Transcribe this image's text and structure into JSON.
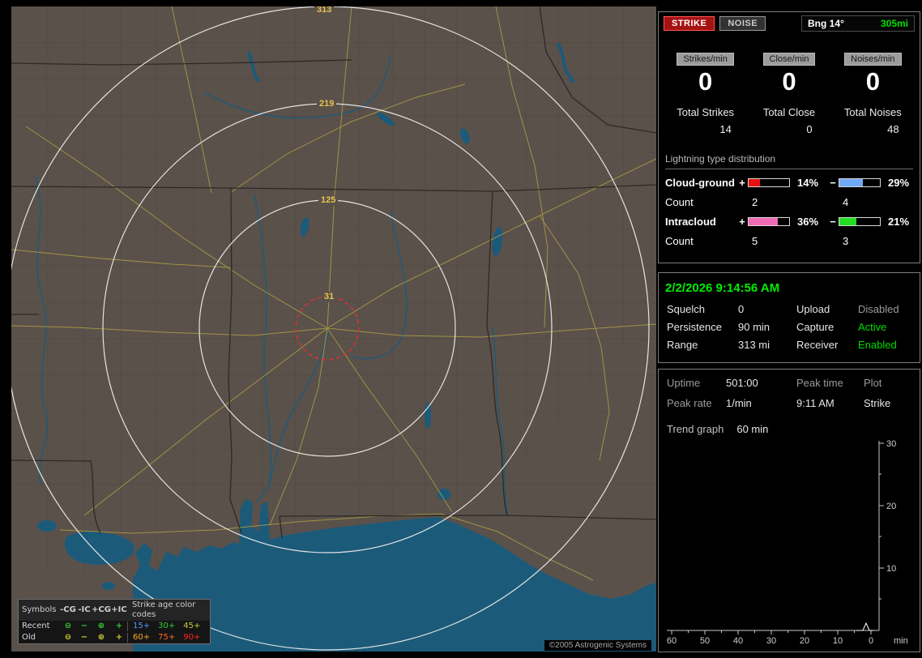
{
  "map": {
    "range_rings": [
      {
        "label": "313"
      },
      {
        "label": "219"
      },
      {
        "label": "125"
      },
      {
        "label": "31"
      }
    ],
    "copyright": "©2005 Astrogenic Systems",
    "legend": {
      "symbols_header": "Symbols",
      "symbol_columns": [
        "-CG",
        "-IC",
        "+CG",
        "+IC"
      ],
      "symbol_glyphs": [
        "⊖",
        "−",
        "⊕",
        "+"
      ],
      "age_header": "Strike age color codes",
      "recent": {
        "label": "Recent",
        "symbol_color": "#33cc33",
        "ages": [
          {
            "text": "15+",
            "color": "#5599ff"
          },
          {
            "text": "30+",
            "color": "#33cc33"
          },
          {
            "text": "45+",
            "color": "#cccc33"
          }
        ]
      },
      "old": {
        "label": "Old",
        "symbol_color": "#cccc33",
        "ages": [
          {
            "text": "60+",
            "color": "#ffaa22"
          },
          {
            "text": "75+",
            "color": "#ff6622"
          },
          {
            "text": "90+",
            "color": "#ff2222"
          }
        ]
      }
    }
  },
  "header": {
    "strike_button": "STRIKE",
    "noise_button": "NOISE",
    "bearing_label": "Bng 14°",
    "bearing_value": "305mi"
  },
  "counters": [
    {
      "rate_label": "Strikes/min",
      "rate_value": "0",
      "total_label": "Total Strikes",
      "total_value": "14"
    },
    {
      "rate_label": "Close/min",
      "rate_value": "0",
      "total_label": "Total Close",
      "total_value": "0"
    },
    {
      "rate_label": "Noises/min",
      "rate_value": "0",
      "total_label": "Total Noises",
      "total_value": "48"
    }
  ],
  "lightning": {
    "section_title": "Lightning type distribution",
    "rows": [
      {
        "label": "Cloud-ground",
        "plus": "+",
        "minus": "−",
        "pos": {
          "pct": 14,
          "text": "14%",
          "color": "#e81010"
        },
        "neg": {
          "pct": 29,
          "text": "29%",
          "color": "#6fa8f5"
        },
        "count_label": "Count",
        "pos_count": "2",
        "neg_count": "4"
      },
      {
        "label": "Intracloud",
        "plus": "+",
        "minus": "−",
        "pos": {
          "pct": 36,
          "text": "36%",
          "color": "#f06ab4"
        },
        "neg": {
          "pct": 21,
          "text": "21%",
          "color": "#22dd22"
        },
        "count_label": "Count",
        "pos_count": "5",
        "neg_count": "3"
      }
    ]
  },
  "status": {
    "datetime": "2/2/2026 9:14:56 AM",
    "rows": [
      {
        "label1": "Squelch",
        "value1": "0",
        "label2": "Upload",
        "value2": "Disabled",
        "value2_color": "#9a9a9a"
      },
      {
        "label1": "Persistence",
        "value1": "90 min",
        "label2": "Capture",
        "value2": "Active",
        "value2_color": "#00dd00"
      },
      {
        "label1": "Range",
        "value1": "313 mi",
        "label2": "Receiver",
        "value2": "Enabled",
        "value2_color": "#00dd00"
      }
    ]
  },
  "trend": {
    "uptime_label": "Uptime",
    "uptime_value": "501:00",
    "peak_time_label": "Peak time",
    "peak_time_value": "9:11 AM",
    "plot_label": "Plot",
    "plot_value": "Strike",
    "peak_rate_label": "Peak rate",
    "peak_rate_value": "1/min",
    "graph_label": "Trend graph",
    "graph_value": "60 min",
    "chart_data": {
      "type": "line",
      "title": "Strike rate trend (last 60 min)",
      "xlabel": "min",
      "ylabel": "",
      "x_ticks": [
        "60",
        "50",
        "40",
        "30",
        "20",
        "10",
        "0"
      ],
      "y_ticks": [
        "30",
        "20",
        "10"
      ],
      "ylim": [
        0,
        30
      ],
      "x_axis_minutes_ago": [
        60,
        0
      ],
      "series": [
        {
          "name": "Strike",
          "x_minutes_ago": [
            60,
            50,
            40,
            30,
            20,
            10,
            3,
            2,
            1,
            0
          ],
          "y": [
            0,
            0,
            0,
            0,
            0,
            0,
            0,
            1,
            0,
            0
          ]
        }
      ]
    }
  }
}
